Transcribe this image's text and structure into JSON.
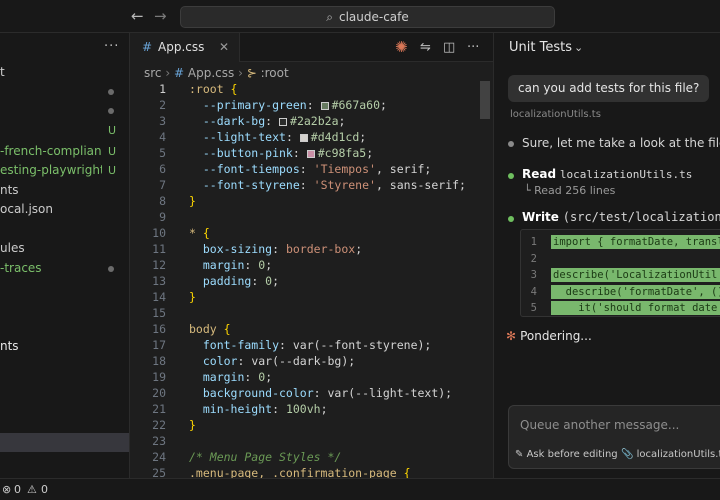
{
  "titlebar": {
    "search_text": "claude-cafe"
  },
  "sidebar": {
    "items": [
      {
        "label": "t",
        "color": "normal",
        "flag": ""
      },
      {
        "label": "",
        "color": "normal",
        "flag": "dot"
      },
      {
        "label": "",
        "color": "normal",
        "flag": "dot"
      },
      {
        "label": "",
        "color": "normal",
        "flag": "U"
      },
      {
        "label": "-french-complian...",
        "color": "green",
        "flag": "U"
      },
      {
        "label": "esting-playwright...",
        "color": "green",
        "flag": "U"
      },
      {
        "label": "nts",
        "color": "normal",
        "flag": ""
      },
      {
        "label": "ocal.json",
        "color": "normal",
        "flag": ""
      },
      {
        "label": "",
        "color": "normal",
        "flag": ""
      },
      {
        "label": "ules",
        "color": "normal",
        "flag": ""
      },
      {
        "label": "-traces",
        "color": "green",
        "flag": "dot"
      },
      {
        "label": "",
        "color": "normal",
        "flag": ""
      },
      {
        "label": "",
        "color": "normal",
        "flag": ""
      },
      {
        "label": "",
        "color": "normal",
        "flag": ""
      },
      {
        "label": "nts",
        "color": "white",
        "flag": ""
      }
    ]
  },
  "editor": {
    "tab_name": "App.css",
    "breadcrumb": {
      "folder": "src",
      "file": "App.css",
      "symbol": ":root"
    },
    "colors": {
      "primary_green": "#667a60",
      "dark_bg": "#2a2b2a",
      "light_text": "#d4d1cd",
      "button_pink": "#c98fa5"
    },
    "lines": [
      {
        "n": "1",
        "tokens": [
          {
            "c": "t-sel",
            "t": ":root "
          },
          {
            "c": "t-brace",
            "t": "{"
          }
        ]
      },
      {
        "n": "2",
        "tokens": [
          {
            "c": "t-prop",
            "t": "  --primary-green"
          },
          {
            "c": "t-punc",
            "t": ": "
          },
          {
            "c": "sw",
            "t": "#667a60"
          },
          {
            "c": "t-num",
            "t": "#667a60"
          },
          {
            "c": "t-punc",
            "t": ";"
          }
        ]
      },
      {
        "n": "3",
        "tokens": [
          {
            "c": "t-prop",
            "t": "  --dark-bg"
          },
          {
            "c": "t-punc",
            "t": ": "
          },
          {
            "c": "sw",
            "t": "#2a2b2a"
          },
          {
            "c": "t-num",
            "t": "#2a2b2a"
          },
          {
            "c": "t-punc",
            "t": ";"
          }
        ]
      },
      {
        "n": "4",
        "tokens": [
          {
            "c": "t-prop",
            "t": "  --light-text"
          },
          {
            "c": "t-punc",
            "t": ": "
          },
          {
            "c": "sw",
            "t": "#d4d1cd"
          },
          {
            "c": "t-num",
            "t": "#d4d1cd"
          },
          {
            "c": "t-punc",
            "t": ";"
          }
        ]
      },
      {
        "n": "5",
        "tokens": [
          {
            "c": "t-prop",
            "t": "  --button-pink"
          },
          {
            "c": "t-punc",
            "t": ": "
          },
          {
            "c": "sw",
            "t": "#c98fa5"
          },
          {
            "c": "t-num",
            "t": "#c98fa5"
          },
          {
            "c": "t-punc",
            "t": ";"
          }
        ]
      },
      {
        "n": "6",
        "tokens": [
          {
            "c": "t-prop",
            "t": "  --font-tiempos"
          },
          {
            "c": "t-punc",
            "t": ": "
          },
          {
            "c": "t-str",
            "t": "'Tiempos'"
          },
          {
            "c": "t-punc",
            "t": ", serif;"
          }
        ]
      },
      {
        "n": "7",
        "tokens": [
          {
            "c": "t-prop",
            "t": "  --font-styrene"
          },
          {
            "c": "t-punc",
            "t": ": "
          },
          {
            "c": "t-str",
            "t": "'Styrene'"
          },
          {
            "c": "t-punc",
            "t": ", sans-serif;"
          }
        ]
      },
      {
        "n": "8",
        "tokens": [
          {
            "c": "t-brace",
            "t": "}"
          }
        ]
      },
      {
        "n": "9",
        "tokens": []
      },
      {
        "n": "10",
        "tokens": [
          {
            "c": "t-sel",
            "t": "* "
          },
          {
            "c": "t-brace",
            "t": "{"
          }
        ]
      },
      {
        "n": "11",
        "tokens": [
          {
            "c": "t-prop",
            "t": "  box-sizing"
          },
          {
            "c": "t-punc",
            "t": ": "
          },
          {
            "c": "t-str",
            "t": "border-box"
          },
          {
            "c": "t-punc",
            "t": ";"
          }
        ]
      },
      {
        "n": "12",
        "tokens": [
          {
            "c": "t-prop",
            "t": "  margin"
          },
          {
            "c": "t-punc",
            "t": ": "
          },
          {
            "c": "t-num",
            "t": "0"
          },
          {
            "c": "t-punc",
            "t": ";"
          }
        ]
      },
      {
        "n": "13",
        "tokens": [
          {
            "c": "t-prop",
            "t": "  padding"
          },
          {
            "c": "t-punc",
            "t": ": "
          },
          {
            "c": "t-num",
            "t": "0"
          },
          {
            "c": "t-punc",
            "t": ";"
          }
        ]
      },
      {
        "n": "14",
        "tokens": [
          {
            "c": "t-brace",
            "t": "}"
          }
        ]
      },
      {
        "n": "15",
        "tokens": []
      },
      {
        "n": "16",
        "tokens": [
          {
            "c": "t-sel",
            "t": "body "
          },
          {
            "c": "t-brace",
            "t": "{"
          }
        ]
      },
      {
        "n": "17",
        "tokens": [
          {
            "c": "t-prop",
            "t": "  font-family"
          },
          {
            "c": "t-punc",
            "t": ": var(--font-styrene);"
          }
        ]
      },
      {
        "n": "18",
        "tokens": [
          {
            "c": "t-prop",
            "t": "  color"
          },
          {
            "c": "t-punc",
            "t": ": var(--dark-bg);"
          }
        ]
      },
      {
        "n": "19",
        "tokens": [
          {
            "c": "t-prop",
            "t": "  margin"
          },
          {
            "c": "t-punc",
            "t": ": "
          },
          {
            "c": "t-num",
            "t": "0"
          },
          {
            "c": "t-punc",
            "t": ";"
          }
        ]
      },
      {
        "n": "20",
        "tokens": [
          {
            "c": "t-prop",
            "t": "  background-color"
          },
          {
            "c": "t-punc",
            "t": ": var(--light-text);"
          }
        ]
      },
      {
        "n": "21",
        "tokens": [
          {
            "c": "t-prop",
            "t": "  min-height"
          },
          {
            "c": "t-punc",
            "t": ": "
          },
          {
            "c": "t-num",
            "t": "100vh"
          },
          {
            "c": "t-punc",
            "t": ";"
          }
        ]
      },
      {
        "n": "22",
        "tokens": [
          {
            "c": "t-brace",
            "t": "}"
          }
        ]
      },
      {
        "n": "23",
        "tokens": []
      },
      {
        "n": "24",
        "tokens": [
          {
            "c": "t-cmt",
            "t": "/* Menu Page Styles */"
          }
        ]
      },
      {
        "n": "25",
        "tokens": [
          {
            "c": "t-sel",
            "t": ".menu-page, .confirmation-page "
          },
          {
            "c": "t-brace",
            "t": "{"
          }
        ]
      }
    ]
  },
  "chat": {
    "title": "Unit Tests",
    "user_message": "can you add tests for this file?",
    "attachment": "localizationUtils.ts",
    "reply": "Sure, let me take a look at the file:",
    "read_label": "Read",
    "read_file": "localizationUtils.ts",
    "read_sub": "└ Read 256 lines",
    "write_label": "Write",
    "write_path": "(src/test/localization.",
    "diff_lines": [
      {
        "n": "1",
        "t": "import { formatDate, translat"
      },
      {
        "n": "2",
        "t": ""
      },
      {
        "n": "3",
        "t": "describe('LocalizationUtil', "
      },
      {
        "n": "4",
        "t": "  describe('formatDate', () ="
      },
      {
        "n": "5",
        "t": "    it('should format date co"
      }
    ],
    "status": "Pondering...",
    "input_placeholder": "Queue another message...",
    "option_edit": "Ask before editing",
    "option_file": "localizationUtils.ts"
  },
  "statusbar": {
    "errors": "0",
    "warnings": "0"
  }
}
